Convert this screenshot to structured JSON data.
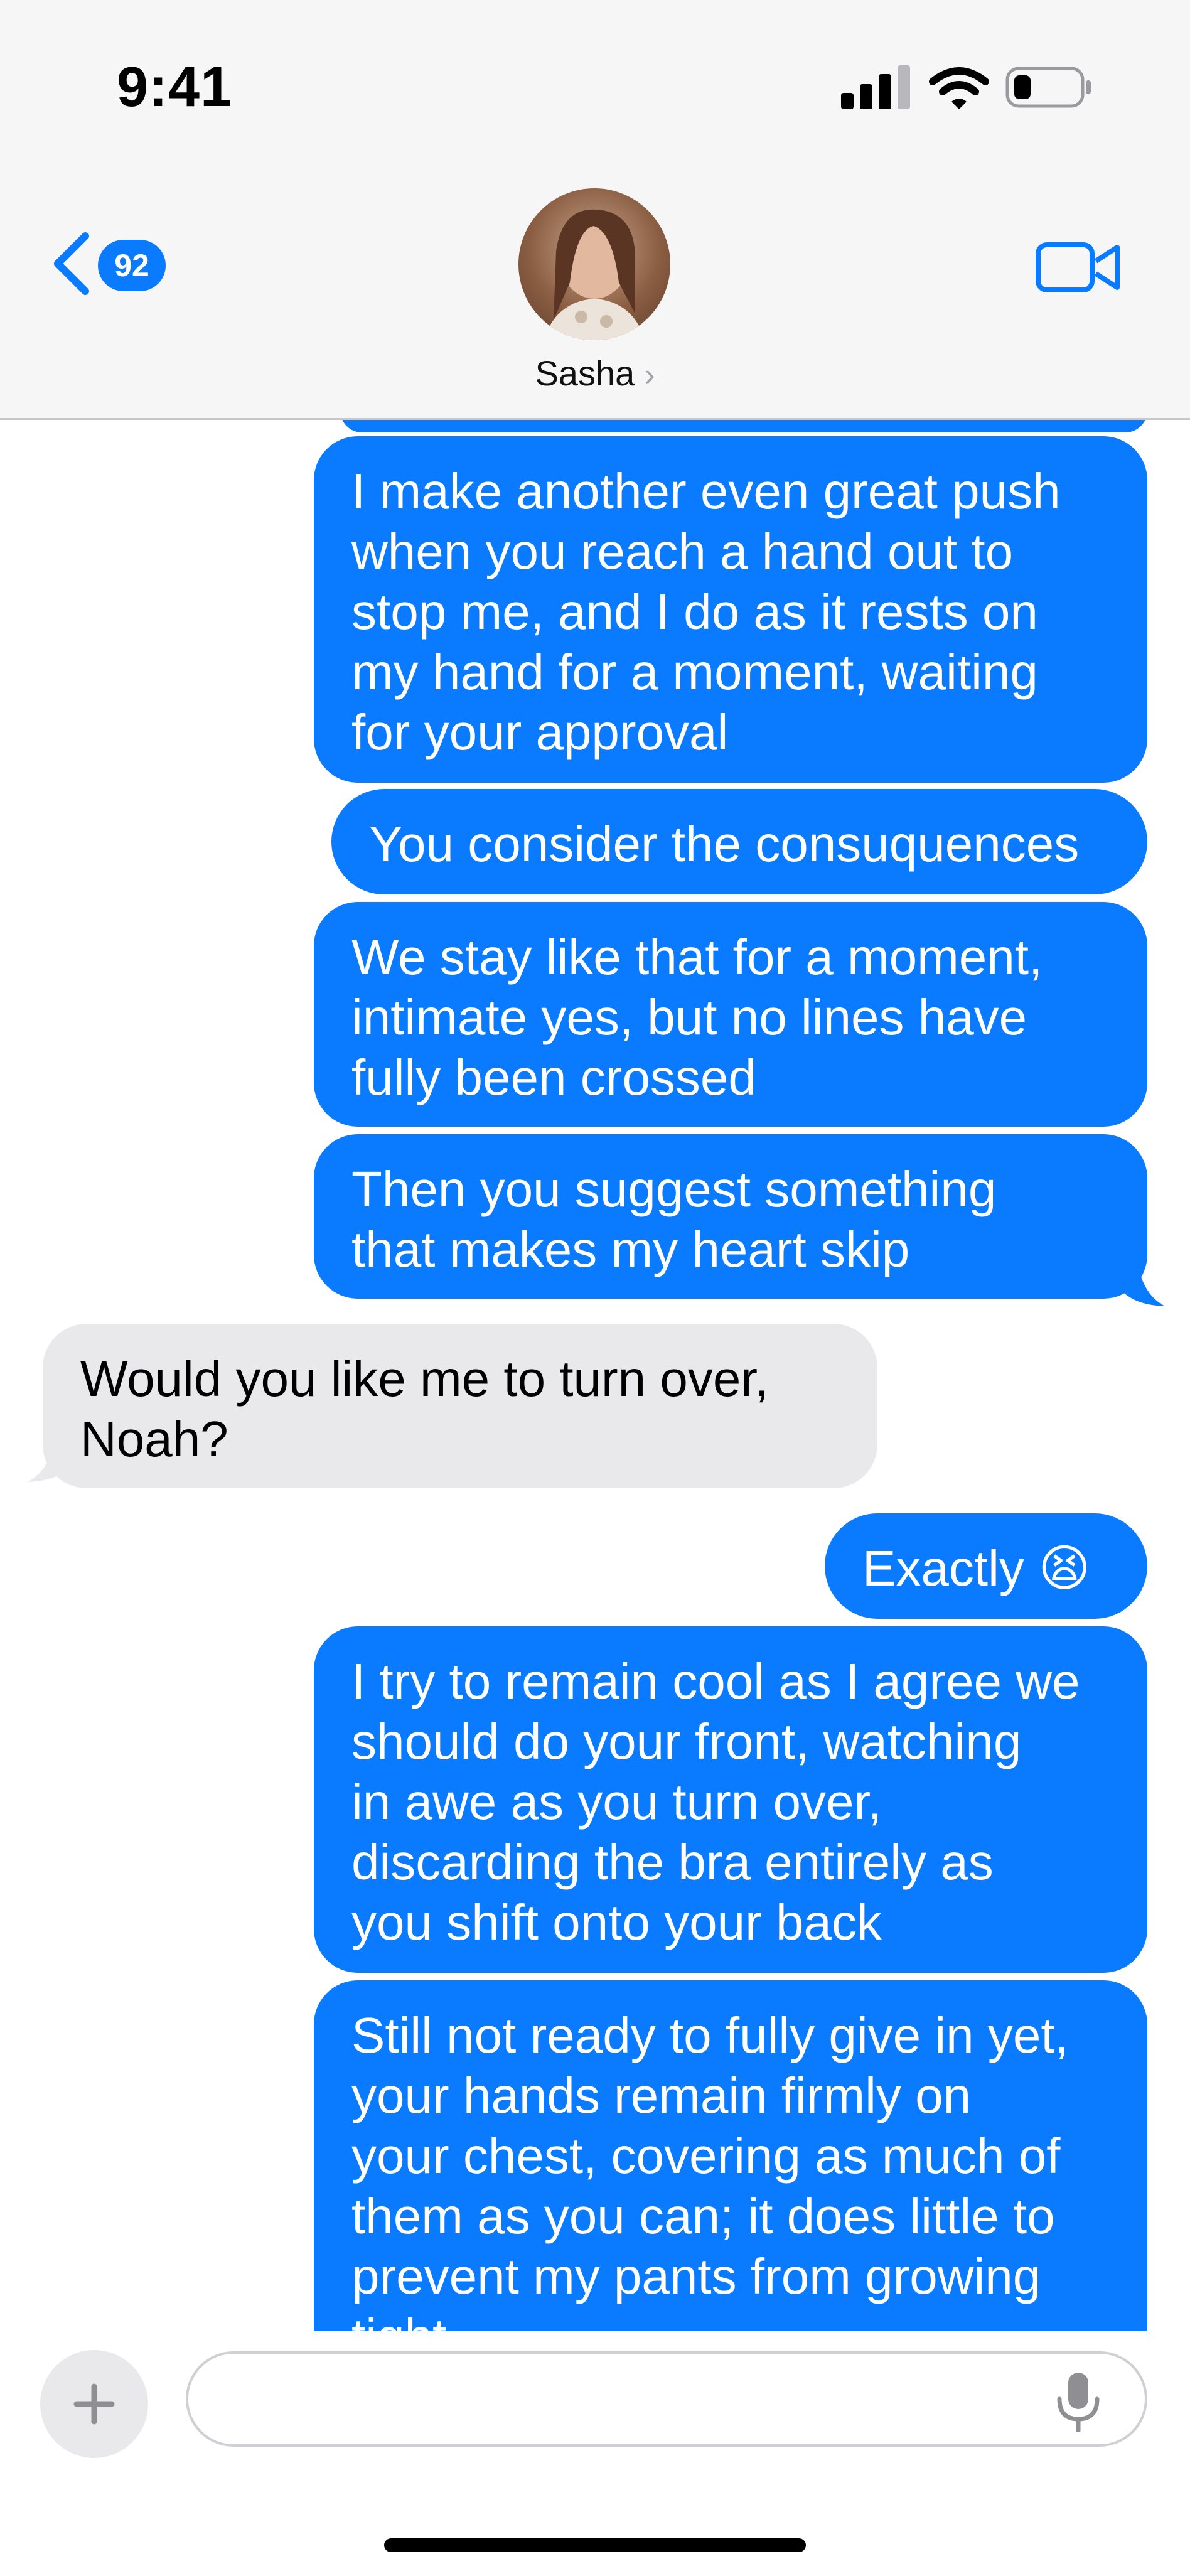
{
  "status_bar": {
    "time": "9:41"
  },
  "nav": {
    "back_badge_count": "92",
    "contact_name": "Sasha",
    "contact_chevron": "›",
    "icons": [
      "back-chevron-icon",
      "video-camera-icon",
      "signal-icon",
      "wifi-icon",
      "battery-icon"
    ]
  },
  "messages": [
    {
      "direction": "outgoing",
      "text": ""
    },
    {
      "direction": "outgoing",
      "text": "I make another even great push\nwhen you reach a hand out to\nstop me, and I do as it rests on\nmy hand for a moment, waiting\nfor your approval"
    },
    {
      "direction": "outgoing",
      "text": "You consider the consuquences"
    },
    {
      "direction": "outgoing",
      "text": "We stay like that for a moment,\nintimate yes, but no lines have\nfully been crossed"
    },
    {
      "direction": "outgoing",
      "text": "Then you suggest something\nthat makes my heart skip"
    },
    {
      "direction": "incoming",
      "text": "Would you like me to turn over,\nNoah?"
    },
    {
      "direction": "outgoing",
      "text": "Exactly 😫"
    },
    {
      "direction": "outgoing",
      "text": "I try to remain cool as I agree we\nshould do your front, watching\nin awe as you turn over,\ndiscarding the bra entirely as\nyou shift onto your back"
    },
    {
      "direction": "outgoing",
      "text": "Still not ready to fully give in yet,\nyour hands remain firmly on\nyour chest, covering as much of\nthem as you can; it does little to\nprevent my pants from growing\ntight"
    }
  ],
  "compose": {
    "placeholder": "",
    "value": "",
    "icons": [
      "plus-icon",
      "microphone-icon"
    ]
  },
  "colors": {
    "outgoing_bubble": "#0a7aff",
    "incoming_bubble": "#e9e9eb",
    "header_bg": "#f6f6f6"
  }
}
